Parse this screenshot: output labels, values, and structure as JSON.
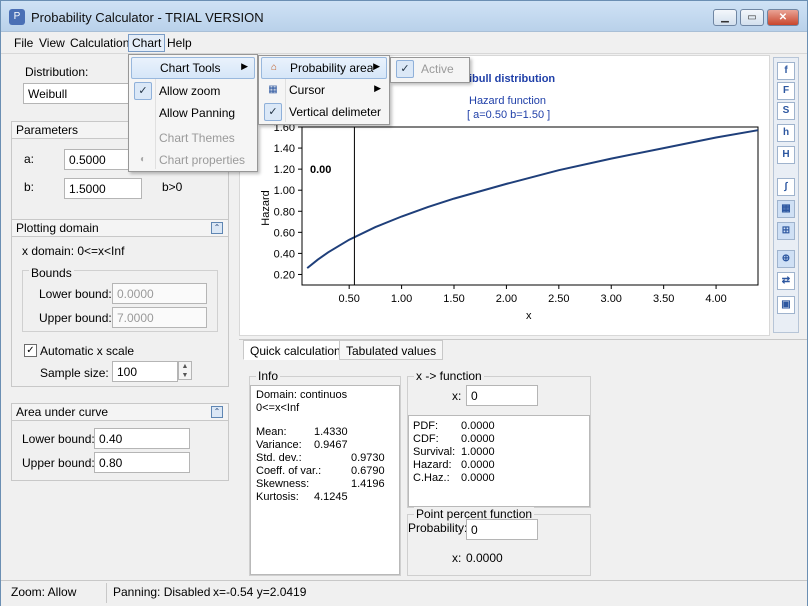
{
  "window": {
    "title": "Probability Calculator - TRIAL VERSION",
    "buttons": {
      "minimize": "▁",
      "maximize": "▭",
      "close": "✕"
    }
  },
  "menubar": {
    "file": "File",
    "view": "View",
    "calculation": "Calculation",
    "chart": "Chart",
    "help": "Help"
  },
  "chart_menu": {
    "chart_tools": "Chart Tools",
    "allow_zoom": "Allow zoom",
    "allow_panning": "Allow Panning",
    "chart_themes": "Chart Themes",
    "chart_properties": "Chart properties"
  },
  "chart_tools_menu": {
    "probability_area": "Probability area",
    "cursor": "Cursor",
    "vertical_delimeter": "Vertical delimeter"
  },
  "probability_area_menu": {
    "active": "Active"
  },
  "left": {
    "distribution_label": "Distribution:",
    "distribution_value": "Weibull",
    "parameters": {
      "title": "Parameters",
      "a_label": "a:",
      "a_value": "0.5000",
      "b_label": "b:",
      "b_value": "1.5000",
      "b_constraint": "b>0"
    },
    "plotting_domain": {
      "title": "Plotting domain",
      "x_domain": "x domain: 0<=x<Inf",
      "bounds_title": "Bounds",
      "lower_label": "Lower bound:",
      "lower_value": "0.0000",
      "upper_label": "Upper bound:",
      "upper_value": "7.0000",
      "auto_scale_label": "Automatic x scale",
      "sample_size_label": "Sample size:",
      "sample_size_value": "100"
    },
    "area_under_curve": {
      "title": "Area under curve",
      "lower_label": "Lower bound:",
      "lower_value": "0.40",
      "upper_label": "Upper bound:",
      "upper_value": "0.80"
    }
  },
  "chart_data": {
    "type": "line",
    "title": "ibull distribution",
    "subtitle": "Hazard function",
    "params_label": "[ a=0.50 b=1.50 ]",
    "xlabel": "x",
    "ylabel": "Hazard",
    "xlim": [
      0.05,
      4.4
    ],
    "ylim": [
      0.1,
      1.6
    ],
    "x_ticks": [
      "0.50",
      "1.00",
      "1.50",
      "2.00",
      "2.50",
      "3.00",
      "3.50",
      "4.00"
    ],
    "x_tick_values": [
      0.5,
      1.0,
      1.5,
      2.0,
      2.5,
      3.0,
      3.5,
      4.0
    ],
    "y_ticks": [
      "0.20",
      "0.40",
      "0.60",
      "0.80",
      "1.00",
      "1.20",
      "1.40",
      "1.60"
    ],
    "y_tick_values": [
      0.2,
      0.4,
      0.6,
      0.8,
      1.0,
      1.2,
      1.4,
      1.6
    ],
    "series": [
      {
        "color": "#1f3f7a",
        "x": [
          0.1,
          0.2,
          0.3,
          0.5,
          0.75,
          1.0,
          1.25,
          1.5,
          2.0,
          2.5,
          3.0,
          3.5,
          4.0,
          4.4
        ],
        "y": [
          0.26,
          0.34,
          0.41,
          0.53,
          0.65,
          0.75,
          0.84,
          0.92,
          1.06,
          1.19,
          1.3,
          1.4,
          1.5,
          1.57
        ]
      }
    ],
    "delimiter_x": 0.55,
    "delimiter_label": "0.00",
    "grid": false
  },
  "toolbar": {
    "buttons": [
      "f",
      "F",
      "S",
      "h",
      "H",
      "∫",
      "▦",
      "⊞",
      "⊕",
      "⇄",
      "▣"
    ]
  },
  "tabs": {
    "quick": "Quick calculation",
    "tabulated": "Tabulated values"
  },
  "info": {
    "title": "Info",
    "domain_line1": "Domain: continuos",
    "domain_line2": "0<=x<Inf",
    "stats": [
      {
        "label": "Mean:",
        "value": "1.4330"
      },
      {
        "label": "Variance:",
        "value": "0.9467"
      },
      {
        "label": "Std. dev.:",
        "value": "0.9730"
      },
      {
        "label": "Coeff. of var.:",
        "value": "0.6790"
      },
      {
        "label": "Skewness:",
        "value": "1.4196"
      },
      {
        "label": "Kurtosis:",
        "value": "4.1245"
      }
    ]
  },
  "x_function": {
    "title": "x -> function",
    "x_label": "x:",
    "x_value": "0",
    "results": [
      {
        "label": "PDF:",
        "value": "0.0000"
      },
      {
        "label": "CDF:",
        "value": "0.0000"
      },
      {
        "label": "Survival:",
        "value": "1.0000"
      },
      {
        "label": "Hazard:",
        "value": "0.0000"
      },
      {
        "label": "C.Haz.:",
        "value": "0.0000"
      }
    ]
  },
  "ppf": {
    "title": "Point percent function",
    "prob_label": "Probability:",
    "prob_value": "0",
    "x_label": "x:",
    "x_value": "0.0000"
  },
  "status": {
    "zoom": "Zoom: Allow",
    "panning": "Panning: Disabled",
    "coords": "x=-0.54  y=2.0419"
  }
}
